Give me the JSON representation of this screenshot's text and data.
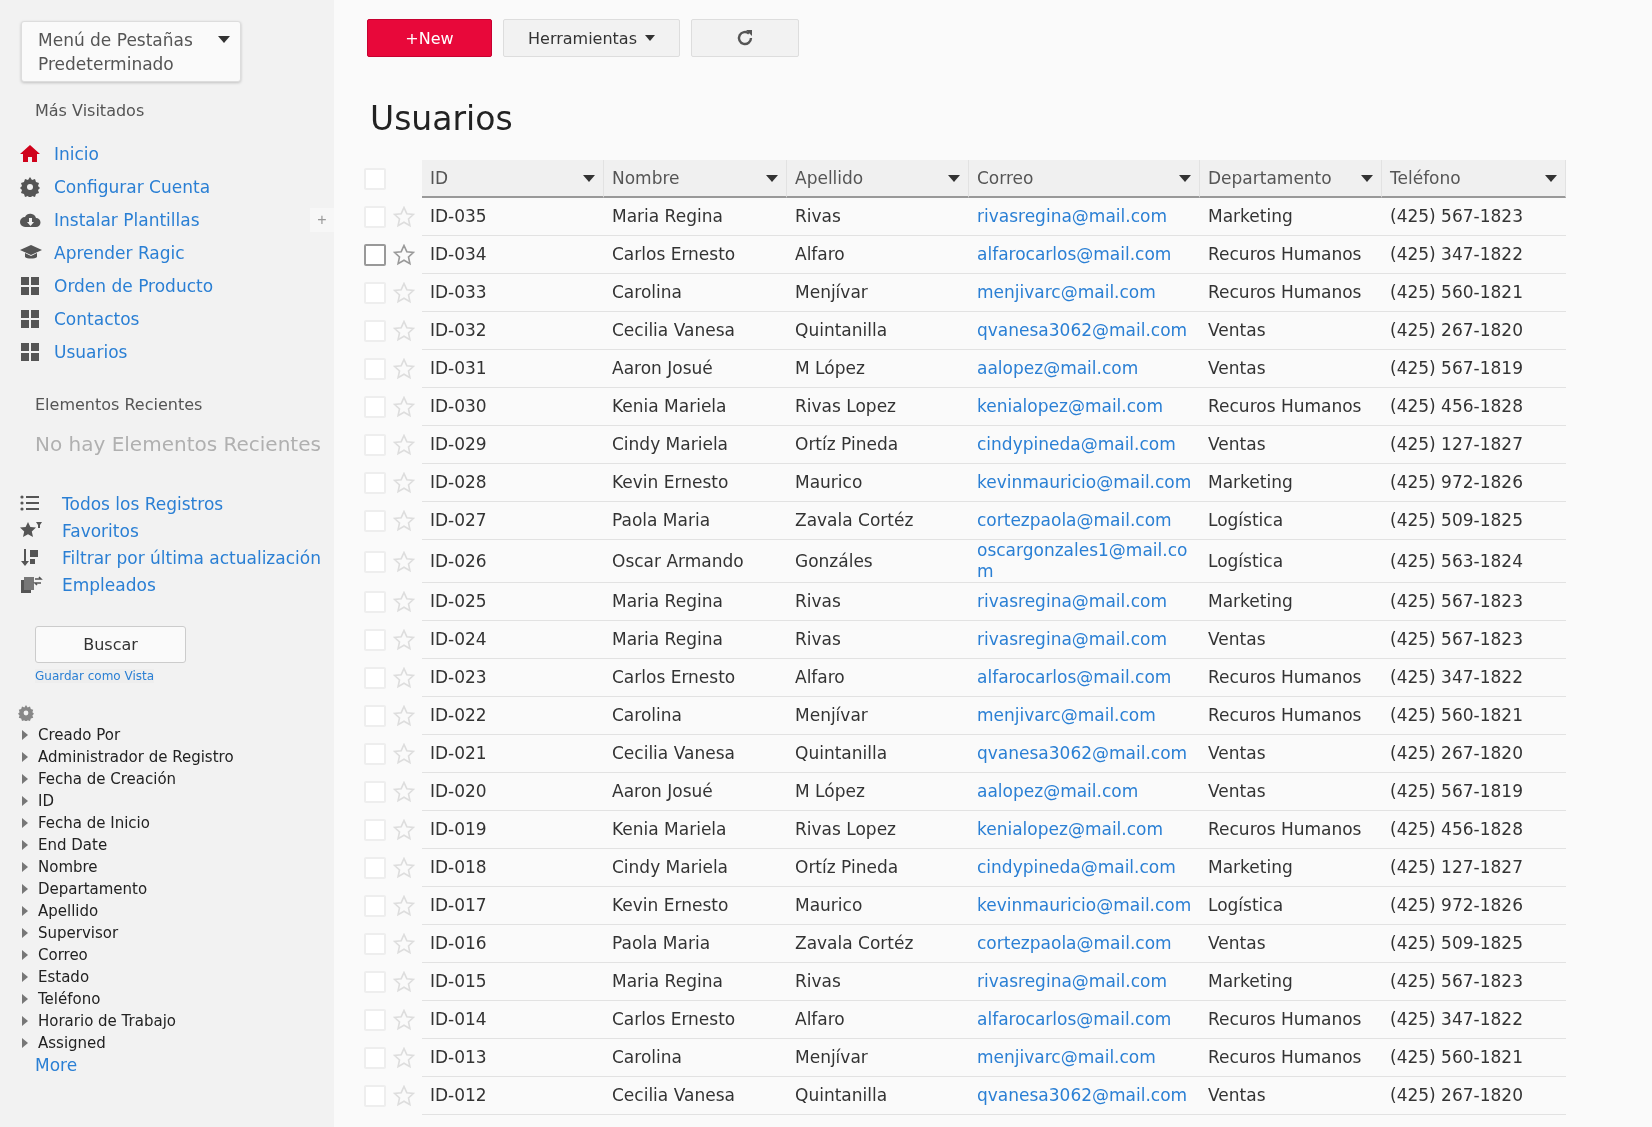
{
  "sidebar": {
    "tab_menu": {
      "label": "Menú de Pestañas Predeterminado"
    },
    "most_visited": {
      "title": "Más Visitados",
      "items": [
        {
          "label": "Inicio"
        },
        {
          "label": "Configurar Cuenta"
        },
        {
          "label": "Instalar Plantillas",
          "add_button": "+"
        },
        {
          "label": "Aprender Ragic"
        },
        {
          "label": "Orden de Producto"
        },
        {
          "label": "Contactos"
        },
        {
          "label": "Usuarios"
        }
      ]
    },
    "recent": {
      "title": "Elementos Recientes",
      "empty_text": "No hay Elementos Recientes"
    },
    "views": [
      {
        "label": "Todos los Registros"
      },
      {
        "label": "Favoritos"
      },
      {
        "label": "Filtrar por última actualización"
      },
      {
        "label": "Empleados"
      }
    ],
    "search_button": "Buscar",
    "save_view_link": "Guardar como Vista",
    "fields": [
      {
        "label": "Creado Por",
        "expanded": false
      },
      {
        "label": "Administrador de Registro",
        "expanded": false
      },
      {
        "label": "Fecha de Creación",
        "expanded": false
      },
      {
        "label": "ID",
        "expanded": false
      },
      {
        "label": "Fecha de Inicio",
        "expanded": false
      },
      {
        "label": "End Date",
        "expanded": false
      },
      {
        "label": "Nombre",
        "expanded": false
      },
      {
        "label": "Departamento",
        "expanded": false
      },
      {
        "label": "Apellido",
        "expanded": false
      },
      {
        "label": "Supervisor",
        "expanded": false
      },
      {
        "label": "Correo",
        "expanded": false
      },
      {
        "label": "Estado",
        "expanded": false
      },
      {
        "label": "Teléfono",
        "expanded": false
      },
      {
        "label": "Horario de Trabajo",
        "expanded": false
      },
      {
        "label": "Assigned",
        "expanded": false
      }
    ],
    "more_link": "More"
  },
  "toolbar": {
    "new_button": "+New",
    "tools_button": "Herramientas"
  },
  "page_title": "Usuarios",
  "table": {
    "columns": [
      "ID",
      "Nombre",
      "Apellido",
      "Correo",
      "Departamento",
      "Teléfono"
    ],
    "select_all": {
      "checked": false
    },
    "rows": [
      {
        "checked": false,
        "hovered": false,
        "cells": [
          "ID-035",
          "Maria Regina",
          "Rivas",
          "rivasregina@mail.com",
          "Marketing",
          "(425) 567-1823"
        ]
      },
      {
        "checked": false,
        "hovered": true,
        "cells": [
          "ID-034",
          "Carlos Ernesto",
          "Alfaro",
          "alfarocarlos@mail.com",
          "Recuros Humanos",
          "(425) 347-1822"
        ]
      },
      {
        "checked": false,
        "hovered": false,
        "cells": [
          "ID-033",
          "Carolina",
          "Menjívar",
          "menjivarc@mail.com",
          "Recuros Humanos",
          "(425) 560-1821"
        ]
      },
      {
        "checked": false,
        "hovered": false,
        "cells": [
          "ID-032",
          "Cecilia Vanesa",
          "Quintanilla",
          "qvanesa3062@mail.com",
          "Ventas",
          "(425) 267-1820"
        ]
      },
      {
        "checked": false,
        "hovered": false,
        "cells": [
          "ID-031",
          "Aaron Josué",
          "M López",
          "aalopez@mail.com",
          "Ventas",
          "(425) 567-1819"
        ]
      },
      {
        "checked": false,
        "hovered": false,
        "cells": [
          "ID-030",
          "Kenia Mariela",
          "Rivas Lopez",
          "kenialopez@mail.com",
          "Recuros Humanos",
          "(425) 456-1828"
        ]
      },
      {
        "checked": false,
        "hovered": false,
        "cells": [
          "ID-029",
          "Cindy Mariela",
          "Ortíz Pineda",
          "cindypineda@mail.com",
          "Ventas",
          "(425) 127-1827"
        ]
      },
      {
        "checked": false,
        "hovered": false,
        "cells": [
          "ID-028",
          "Kevin Ernesto",
          "Maurico",
          "kevinmauricio@mail.com",
          "Marketing",
          "(425) 972-1826"
        ]
      },
      {
        "checked": false,
        "hovered": false,
        "cells": [
          "ID-027",
          "Paola Maria",
          "Zavala Cortéz",
          "cortezpaola@mail.com",
          "Logística",
          "(425) 509-1825"
        ]
      },
      {
        "checked": false,
        "hovered": false,
        "cells": [
          "ID-026",
          "Oscar Armando",
          "Gonzáles",
          "oscargonzales1@mail.com",
          "Logística",
          "(425) 563-1824"
        ]
      },
      {
        "checked": false,
        "hovered": false,
        "cells": [
          "ID-025",
          "Maria Regina",
          "Rivas",
          "rivasregina@mail.com",
          "Marketing",
          "(425) 567-1823"
        ]
      },
      {
        "checked": false,
        "hovered": false,
        "cells": [
          "ID-024",
          "Maria Regina",
          "Rivas",
          "rivasregina@mail.com",
          "Ventas",
          "(425) 567-1823"
        ]
      },
      {
        "checked": false,
        "hovered": false,
        "cells": [
          "ID-023",
          "Carlos Ernesto",
          "Alfaro",
          "alfarocarlos@mail.com",
          "Recuros Humanos",
          "(425) 347-1822"
        ]
      },
      {
        "checked": false,
        "hovered": false,
        "cells": [
          "ID-022",
          "Carolina",
          "Menjívar",
          "menjivarc@mail.com",
          "Recuros Humanos",
          "(425) 560-1821"
        ]
      },
      {
        "checked": false,
        "hovered": false,
        "cells": [
          "ID-021",
          "Cecilia Vanesa",
          "Quintanilla",
          "qvanesa3062@mail.com",
          "Ventas",
          "(425) 267-1820"
        ]
      },
      {
        "checked": false,
        "hovered": false,
        "cells": [
          "ID-020",
          "Aaron Josué",
          "M López",
          "aalopez@mail.com",
          "Ventas",
          "(425) 567-1819"
        ]
      },
      {
        "checked": false,
        "hovered": false,
        "cells": [
          "ID-019",
          "Kenia Mariela",
          "Rivas Lopez",
          "kenialopez@mail.com",
          "Recuros Humanos",
          "(425) 456-1828"
        ]
      },
      {
        "checked": false,
        "hovered": false,
        "cells": [
          "ID-018",
          "Cindy Mariela",
          "Ortíz Pineda",
          "cindypineda@mail.com",
          "Marketing",
          "(425) 127-1827"
        ]
      },
      {
        "checked": false,
        "hovered": false,
        "cells": [
          "ID-017",
          "Kevin Ernesto",
          "Maurico",
          "kevinmauricio@mail.com",
          "Logística",
          "(425) 972-1826"
        ]
      },
      {
        "checked": false,
        "hovered": false,
        "cells": [
          "ID-016",
          "Paola Maria",
          "Zavala Cortéz",
          "cortezpaola@mail.com",
          "Ventas",
          "(425) 509-1825"
        ]
      },
      {
        "checked": false,
        "hovered": false,
        "cells": [
          "ID-015",
          "Maria Regina",
          "Rivas",
          "rivasregina@mail.com",
          "Marketing",
          "(425) 567-1823"
        ]
      },
      {
        "checked": false,
        "hovered": false,
        "cells": [
          "ID-014",
          "Carlos Ernesto",
          "Alfaro",
          "alfarocarlos@mail.com",
          "Recuros Humanos",
          "(425) 347-1822"
        ]
      },
      {
        "checked": false,
        "hovered": false,
        "cells": [
          "ID-013",
          "Carolina",
          "Menjívar",
          "menjivarc@mail.com",
          "Recuros Humanos",
          "(425) 560-1821"
        ]
      },
      {
        "checked": false,
        "hovered": false,
        "cells": [
          "ID-012",
          "Cecilia Vanesa",
          "Quintanilla",
          "qvanesa3062@mail.com",
          "Ventas",
          "(425) 267-1820"
        ]
      }
    ]
  }
}
